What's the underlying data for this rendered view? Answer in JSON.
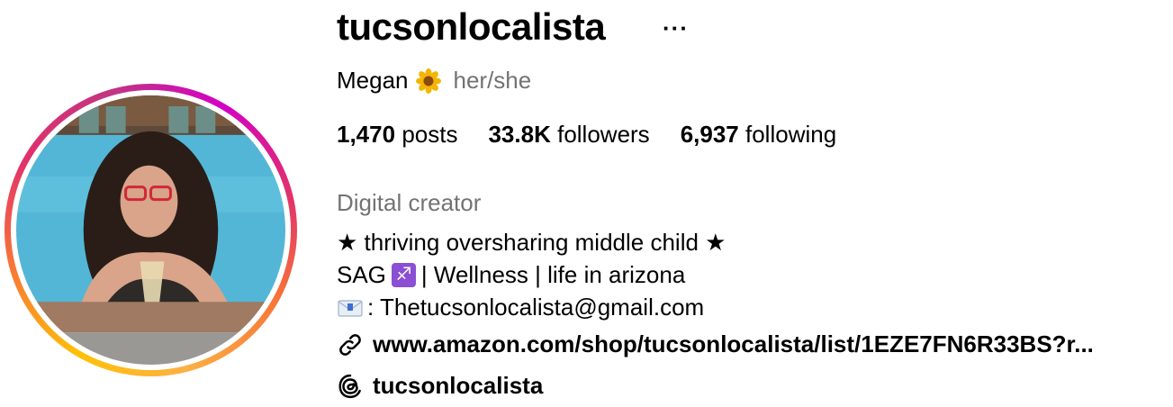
{
  "profile": {
    "username": "tucsonlocalista",
    "more_label": "···",
    "full_name": "Megan",
    "pronouns": "her/she",
    "stats": {
      "posts_count": "1,470",
      "posts_label": "posts",
      "followers_count": "33.8K",
      "followers_label": "followers",
      "following_count": "6,937",
      "following_label": "following"
    },
    "category": "Digital creator",
    "bio": {
      "line1": "★ thriving oversharing middle child ★",
      "line2_prefix": "SAG",
      "line2_suffix": "| Wellness | life in arizona",
      "line3_email": ": Thetucsonlocalista@gmail.com"
    },
    "link": "www.amazon.com/shop/tucsonlocalista/list/1EZE7FN6R33BS?r...",
    "threads_handle": "tucsonlocalista"
  },
  "icons": {
    "flower": "sunflower-emoji",
    "sagittarius": "sagittarius-emoji",
    "email": "envelope-emoji",
    "link": "link-icon",
    "threads": "threads-icon"
  },
  "colors": {
    "secondary_text": "#737373",
    "ring_start": "#ffc107",
    "ring_mid": "#e1306c",
    "ring_end": "#d300c5"
  }
}
